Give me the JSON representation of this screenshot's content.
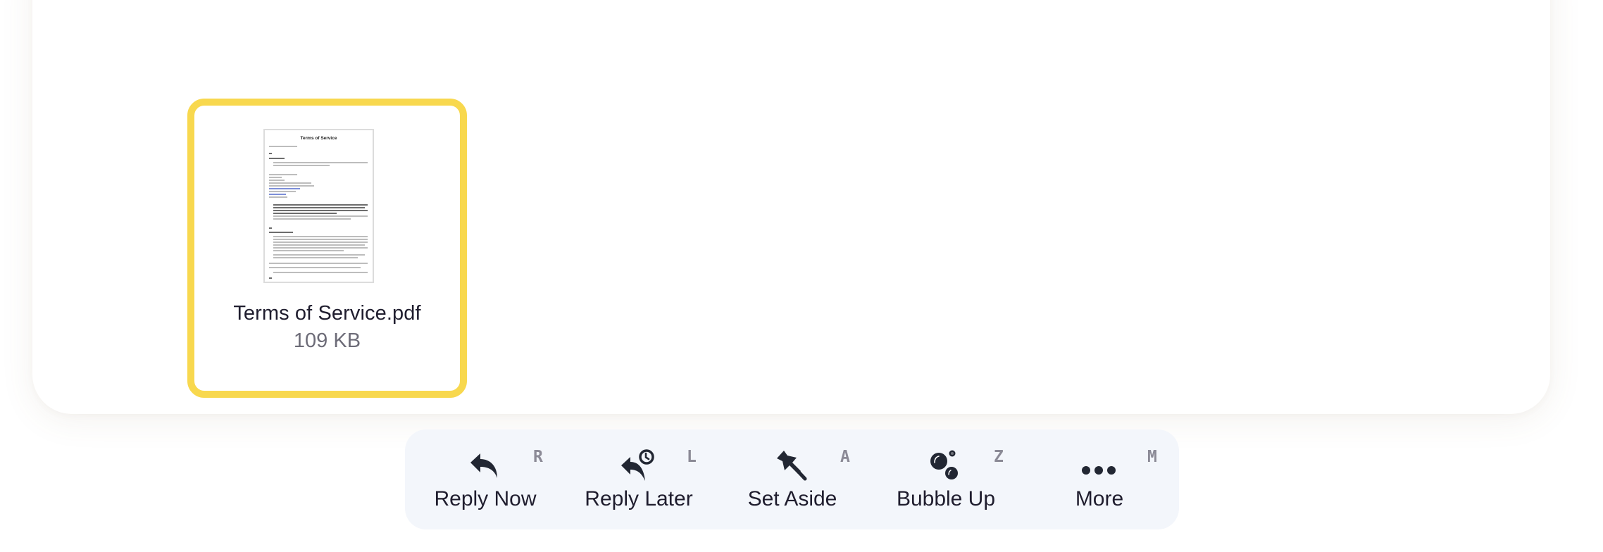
{
  "attachment": {
    "file_name": "Terms of Service.pdf",
    "file_size": "109 KB",
    "thumbnail_title": "Terms of Service",
    "highlight_color": "#f8d84e"
  },
  "toolbar": {
    "items": [
      {
        "label": "Reply Now",
        "shortcut": "R",
        "icon": "reply-icon"
      },
      {
        "label": "Reply Later",
        "shortcut": "L",
        "icon": "reply-later-clock-icon"
      },
      {
        "label": "Set Aside",
        "shortcut": "A",
        "icon": "pin-icon"
      },
      {
        "label": "Bubble Up",
        "shortcut": "Z",
        "icon": "bubbles-icon"
      },
      {
        "label": "More",
        "shortcut": "M",
        "icon": "more-dots-icon"
      }
    ]
  }
}
